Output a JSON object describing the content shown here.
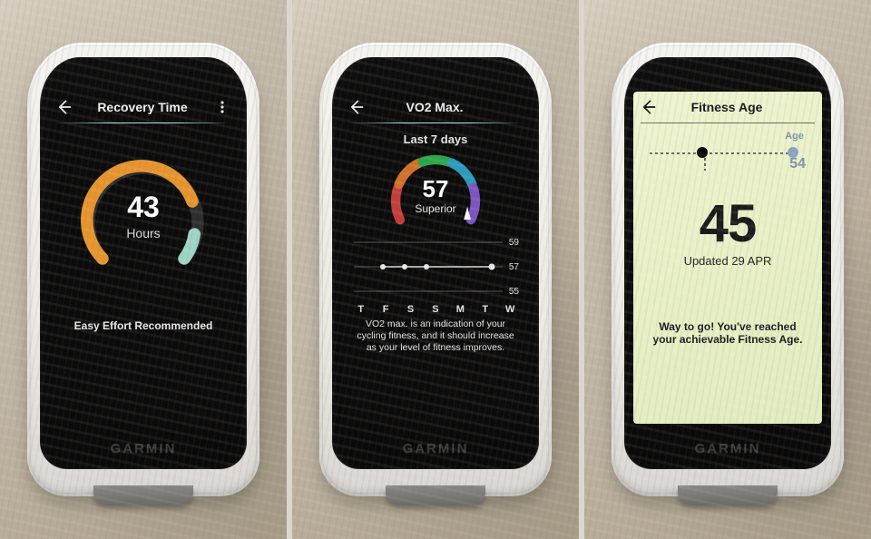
{
  "brand": "GARMIN",
  "devices": [
    {
      "id": "recovery",
      "header": {
        "title": "Recovery Time",
        "has_more": true
      },
      "gauge": {
        "value": 43,
        "unit": "Hours",
        "track_color": "#2d2d2d",
        "fill_color": "#e6952e",
        "tail_color": "#9ed4c7",
        "fill_ratio": 0.72
      },
      "footer": "Easy Effort Recommended"
    },
    {
      "id": "vo2",
      "header": {
        "title": "VO2 Max.",
        "has_more": false
      },
      "subheading": "Last 7 days",
      "gauge": {
        "value": 57,
        "label": "Superior",
        "segments": [
          {
            "color": "#c43c3b"
          },
          {
            "color": "#d2712a"
          },
          {
            "color": "#2aa74c"
          },
          {
            "color": "#2a9bbd"
          },
          {
            "color": "#7d54c4"
          }
        ]
      },
      "trend": {
        "y_ticks": [
          59,
          57,
          55
        ],
        "values": [
          null,
          57,
          57,
          57,
          null,
          null,
          57
        ],
        "days": [
          "T",
          "F",
          "S",
          "S",
          "M",
          "T",
          "W"
        ]
      },
      "description": "VO2 max. is an indication of your cycling fitness, and it should increase as your level of fitness improves.",
      "chart_data": {
        "type": "line",
        "title": "VO2 Max. — Last 7 days",
        "categories": [
          "T",
          "F",
          "S",
          "S",
          "M",
          "T",
          "W"
        ],
        "values": [
          null,
          57,
          57,
          57,
          null,
          null,
          57
        ],
        "ylim": [
          55,
          59
        ],
        "ylabel": "VO2 Max."
      }
    },
    {
      "id": "fitness_age",
      "header": {
        "title": "Fitness Age",
        "has_more": false
      },
      "slider": {
        "age_label": "Age",
        "actual_age": 54,
        "current_marker_ratio": 0.35
      },
      "value": 45,
      "updated_label": "Updated 29 APR",
      "footer": "Way to go! You've reached your achievable Fitness Age."
    }
  ]
}
